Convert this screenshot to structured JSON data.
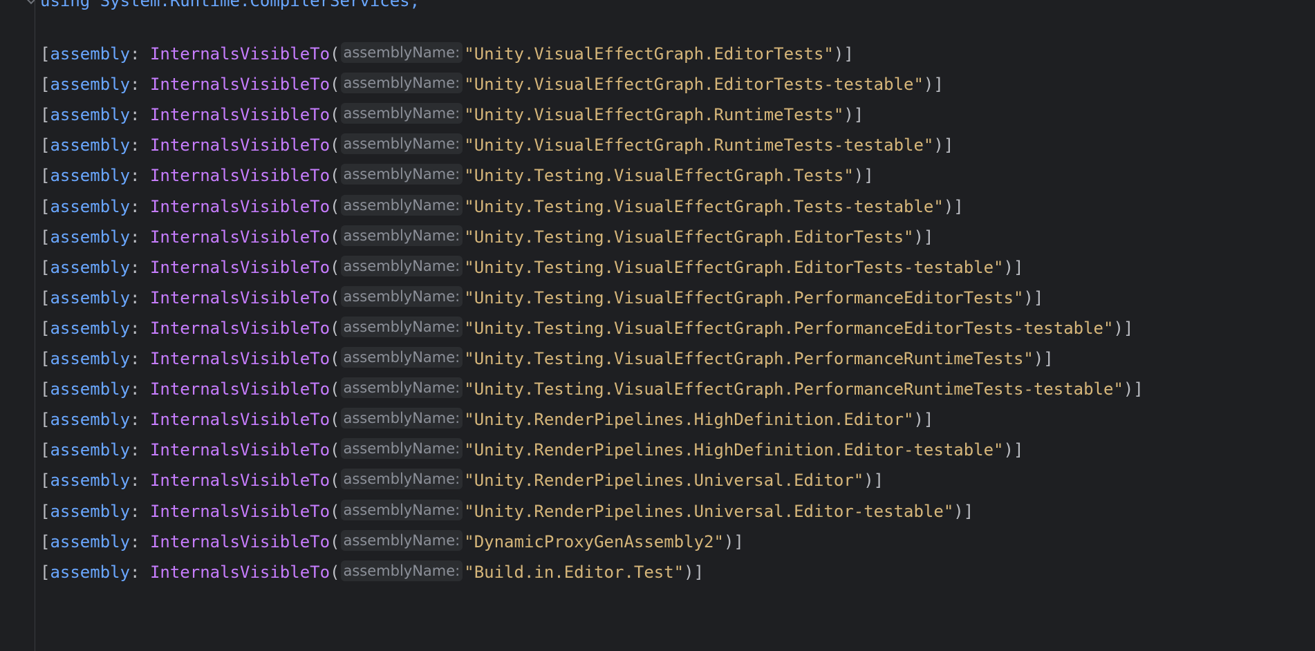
{
  "editor": {
    "top_partial_line": "using System.Runtime.CompilerServices;",
    "lines": [
      {
        "keyword": "assembly",
        "attribute": "InternalsVisibleTo",
        "hint": "assemblyName:",
        "value": "\"Unity.VisualEffectGraph.EditorTests\""
      },
      {
        "keyword": "assembly",
        "attribute": "InternalsVisibleTo",
        "hint": "assemblyName:",
        "value": "\"Unity.VisualEffectGraph.EditorTests-testable\""
      },
      {
        "keyword": "assembly",
        "attribute": "InternalsVisibleTo",
        "hint": "assemblyName:",
        "value": "\"Unity.VisualEffectGraph.RuntimeTests\""
      },
      {
        "keyword": "assembly",
        "attribute": "InternalsVisibleTo",
        "hint": "assemblyName:",
        "value": "\"Unity.VisualEffectGraph.RuntimeTests-testable\""
      },
      {
        "keyword": "assembly",
        "attribute": "InternalsVisibleTo",
        "hint": "assemblyName:",
        "value": "\"Unity.Testing.VisualEffectGraph.Tests\""
      },
      {
        "keyword": "assembly",
        "attribute": "InternalsVisibleTo",
        "hint": "assemblyName:",
        "value": "\"Unity.Testing.VisualEffectGraph.Tests-testable\""
      },
      {
        "keyword": "assembly",
        "attribute": "InternalsVisibleTo",
        "hint": "assemblyName:",
        "value": "\"Unity.Testing.VisualEffectGraph.EditorTests\""
      },
      {
        "keyword": "assembly",
        "attribute": "InternalsVisibleTo",
        "hint": "assemblyName:",
        "value": "\"Unity.Testing.VisualEffectGraph.EditorTests-testable\""
      },
      {
        "keyword": "assembly",
        "attribute": "InternalsVisibleTo",
        "hint": "assemblyName:",
        "value": "\"Unity.Testing.VisualEffectGraph.PerformanceEditorTests\""
      },
      {
        "keyword": "assembly",
        "attribute": "InternalsVisibleTo",
        "hint": "assemblyName:",
        "value": "\"Unity.Testing.VisualEffectGraph.PerformanceEditorTests-testable\""
      },
      {
        "keyword": "assembly",
        "attribute": "InternalsVisibleTo",
        "hint": "assemblyName:",
        "value": "\"Unity.Testing.VisualEffectGraph.PerformanceRuntimeTests\""
      },
      {
        "keyword": "assembly",
        "attribute": "InternalsVisibleTo",
        "hint": "assemblyName:",
        "value": "\"Unity.Testing.VisualEffectGraph.PerformanceRuntimeTests-testable\""
      },
      {
        "keyword": "assembly",
        "attribute": "InternalsVisibleTo",
        "hint": "assemblyName:",
        "value": "\"Unity.RenderPipelines.HighDefinition.Editor\""
      },
      {
        "keyword": "assembly",
        "attribute": "InternalsVisibleTo",
        "hint": "assemblyName:",
        "value": "\"Unity.RenderPipelines.HighDefinition.Editor-testable\""
      },
      {
        "keyword": "assembly",
        "attribute": "InternalsVisibleTo",
        "hint": "assemblyName:",
        "value": "\"Unity.RenderPipelines.Universal.Editor\""
      },
      {
        "keyword": "assembly",
        "attribute": "InternalsVisibleTo",
        "hint": "assemblyName:",
        "value": "\"Unity.RenderPipelines.Universal.Editor-testable\""
      },
      {
        "keyword": "assembly",
        "attribute": "InternalsVisibleTo",
        "hint": "assemblyName:",
        "value": "\"DynamicProxyGenAssembly2\""
      },
      {
        "keyword": "assembly",
        "attribute": "InternalsVisibleTo",
        "hint": "assemblyName:",
        "value": "\"Build.in.Editor.Test\""
      }
    ]
  },
  "colors": {
    "background": "#1e1f22",
    "keyword": "#6aa7ff",
    "attribute": "#c77dff",
    "string": "#d6b67a",
    "punctuation": "#bcbec4",
    "hint_text": "#8c9099",
    "hint_background": "#2b2d30"
  }
}
